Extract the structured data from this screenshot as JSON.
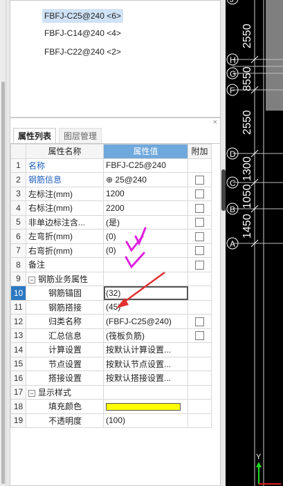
{
  "top_list": {
    "items": [
      {
        "label": "FBFJ-C25@240 <6>",
        "selected": true
      },
      {
        "label": "FBFJ-C14@240 <4>",
        "selected": false
      },
      {
        "label": "FBFJ-C22@240 <2>",
        "selected": false
      }
    ]
  },
  "panel": {
    "close_label": "×",
    "tabs": [
      {
        "label": "属性列表",
        "active": true
      },
      {
        "label": "图层管理",
        "active": false
      }
    ],
    "columns": [
      "属性名称",
      "属性值",
      "附加"
    ],
    "rows": [
      {
        "n": "1",
        "name": "名称",
        "value": "FBFJ-C25@240",
        "blue": true
      },
      {
        "n": "2",
        "name": "钢筋信息",
        "value": "⊕ 25@240",
        "blue": true,
        "check": true
      },
      {
        "n": "3",
        "name": "左标注(mm)",
        "value": "1200",
        "check": true
      },
      {
        "n": "4",
        "name": "右标注(mm)",
        "value": "2200",
        "check": true
      },
      {
        "n": "5",
        "name": "非单边标注含...",
        "value": "(是)",
        "check": true
      },
      {
        "n": "6",
        "name": "左弯折(mm)",
        "value": "(0)",
        "check": true
      },
      {
        "n": "7",
        "name": "右弯折(mm)",
        "value": "(0)",
        "check": true
      },
      {
        "n": "8",
        "name": "备注",
        "value": "",
        "check": true
      },
      {
        "n": "9",
        "name": "钢筋业务属性",
        "value": "",
        "expander": "−"
      },
      {
        "n": "10",
        "name": "钢筋锚固",
        "value": "(32)",
        "indent": 2,
        "selected": true
      },
      {
        "n": "11",
        "name": "钢筋搭接",
        "value": "(45)",
        "indent": 2
      },
      {
        "n": "12",
        "name": "归类名称",
        "value": "(FBFJ-C25@240)",
        "indent": 2,
        "check": true
      },
      {
        "n": "13",
        "name": "汇总信息",
        "value": "(筏板负筋)",
        "indent": 2,
        "check": true
      },
      {
        "n": "14",
        "name": "计算设置",
        "value": "按默认计算设置...",
        "indent": 2
      },
      {
        "n": "15",
        "name": "节点设置",
        "value": "按默认节点设置...",
        "indent": 2
      },
      {
        "n": "16",
        "name": "搭接设置",
        "value": "按默认搭接设置...",
        "indent": 2
      },
      {
        "n": "17",
        "name": "显示样式",
        "value": "",
        "expander": "−"
      },
      {
        "n": "18",
        "name": "填充颜色",
        "value": "",
        "indent": 2,
        "swatch": true
      },
      {
        "n": "19",
        "name": "不透明度",
        "value": "(100)",
        "indent": 2
      }
    ]
  },
  "cad": {
    "dims": [
      "2550",
      "8550",
      "2550",
      "1300",
      "1450",
      "1050"
    ],
    "axes": [
      "J",
      "H",
      "G",
      "F",
      "D",
      "C",
      "B",
      "A"
    ],
    "ucs_label": "Y"
  },
  "colors": {
    "swatch": "#ffff00",
    "annotation": "#e020e0",
    "arrow": "#e03030"
  }
}
